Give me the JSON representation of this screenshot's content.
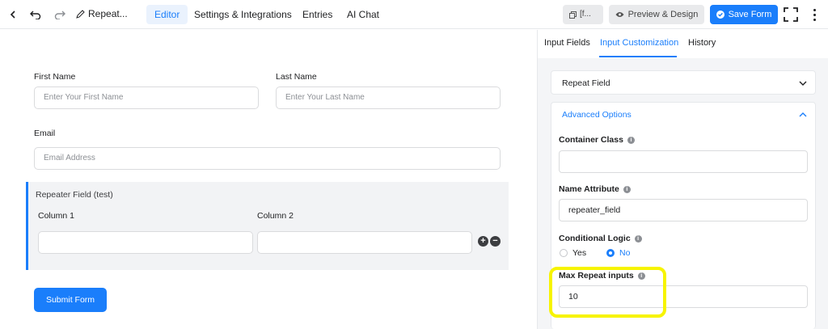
{
  "toolbar": {
    "form_title": "Repeat...",
    "tabs": [
      {
        "label": "Editor"
      },
      {
        "label": "Settings & Integrations"
      },
      {
        "label": "Entries"
      },
      {
        "label": "AI Chat"
      }
    ],
    "shortcode_label": "[f...",
    "preview_label": "Preview & Design",
    "save_label": "Save Form"
  },
  "form": {
    "first_name": {
      "label": "First Name",
      "placeholder": "Enter Your First Name"
    },
    "last_name": {
      "label": "Last Name",
      "placeholder": "Enter Your Last Name"
    },
    "email": {
      "label": "Email",
      "placeholder": "Email Address"
    },
    "repeater": {
      "title": "Repeater Field (test)",
      "columns": [
        {
          "label": "Column 1"
        },
        {
          "label": "Column 2"
        }
      ],
      "add_symbol": "+",
      "remove_symbol": "−"
    },
    "submit_label": "Submit Form"
  },
  "panel": {
    "tabs": [
      {
        "label": "Input Fields"
      },
      {
        "label": "Input Customization"
      },
      {
        "label": "History"
      }
    ],
    "repeat_field_title": "Repeat Field",
    "advanced_title": "Advanced Options",
    "container_class": {
      "label": "Container Class",
      "value": ""
    },
    "name_attribute": {
      "label": "Name Attribute",
      "value": "repeater_field"
    },
    "conditional_logic": {
      "label": "Conditional Logic",
      "options": [
        {
          "label": "Yes"
        },
        {
          "label": "No"
        }
      ],
      "selected": "No"
    },
    "max_repeat": {
      "label": "Max Repeat inputs",
      "value": "10"
    }
  },
  "colors": {
    "accent": "#1a7efb",
    "highlight": "#f7f400"
  }
}
